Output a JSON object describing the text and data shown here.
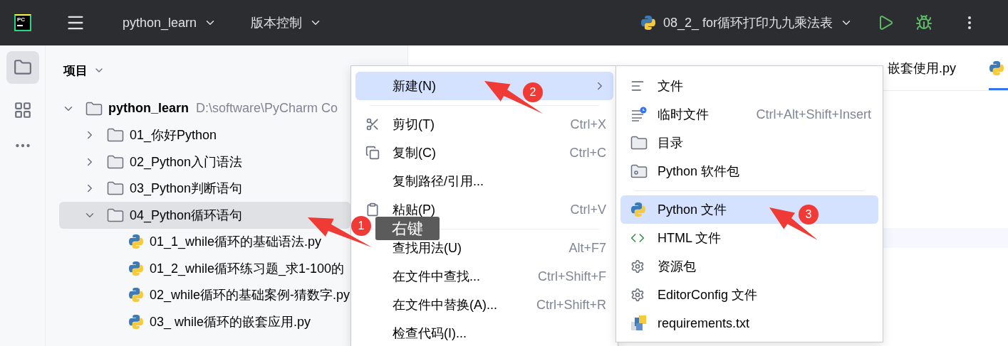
{
  "topbar": {
    "logo_text": "PC",
    "project": "python_learn",
    "vcs": "版本控制",
    "run_config": "08_2_ for循环打印九九乘法表"
  },
  "tool_strip": [
    {
      "selected": true
    },
    {
      "selected": false
    }
  ],
  "project_panel": {
    "title": "项目",
    "tree": [
      {
        "name": "python_learn",
        "path": "D:\\software\\PyCharm Co",
        "kind": "folder",
        "expanded": true,
        "selected": false,
        "children": [
          {
            "name": "01_你好Python",
            "kind": "folder",
            "expanded": false,
            "selected": false
          },
          {
            "name": "02_Python入门语法",
            "kind": "folder",
            "expanded": false,
            "selected": false
          },
          {
            "name": "03_Python判断语句",
            "kind": "folder",
            "expanded": false,
            "selected": false
          },
          {
            "name": "04_Python循环语句",
            "kind": "folder",
            "expanded": true,
            "selected": true,
            "children": [
              {
                "name": "01_1_while循环的基础语法.py",
                "kind": "file",
                "selected": false
              },
              {
                "name": "01_2_while循环练习题_求1-100的",
                "kind": "file",
                "selected": false
              },
              {
                "name": "02_while循环的基础案例-猜数字.py",
                "kind": "file",
                "selected": false
              },
              {
                "name": "03_ while循环的嵌套应用.py",
                "kind": "file",
                "selected": false
              }
            ]
          }
        ]
      }
    ]
  },
  "editor": {
    "tabs": [
      {
        "label": "嵌套使用.py",
        "selected": false
      },
      {
        "selected": true
      }
    ]
  },
  "context_menu": {
    "items": [
      {
        "kind": "item",
        "label": "新建(N)",
        "submenu": true,
        "selected": true
      },
      {
        "kind": "separator"
      },
      {
        "kind": "item",
        "label": "剪切(T)",
        "shortcut": "Ctrl+X",
        "selected": false
      },
      {
        "kind": "item",
        "label": "复制(C)",
        "shortcut": "Ctrl+C",
        "selected": false
      },
      {
        "kind": "item",
        "label": "复制路径/引用...",
        "selected": false
      },
      {
        "kind": "item",
        "label": "粘贴(P)",
        "shortcut": "Ctrl+V",
        "selected": false
      },
      {
        "kind": "separator"
      },
      {
        "kind": "item",
        "label": "查找用法(U)",
        "shortcut": "Alt+F7",
        "selected": false
      },
      {
        "kind": "item",
        "label": "在文件中查找...",
        "shortcut": "Ctrl+Shift+F",
        "selected": false
      },
      {
        "kind": "item",
        "label": "在文件中替换(A)...",
        "shortcut": "Ctrl+Shift+R",
        "selected": false
      },
      {
        "kind": "item",
        "label": "检查代码(I)...",
        "selected": false
      }
    ]
  },
  "submenu": {
    "items": [
      {
        "kind": "item",
        "label": "文件",
        "selected": false
      },
      {
        "kind": "item",
        "label": "临时文件",
        "shortcut": "Ctrl+Alt+Shift+Insert",
        "selected": false
      },
      {
        "kind": "item",
        "label": "目录",
        "selected": false
      },
      {
        "kind": "item",
        "label": "Python 软件包",
        "selected": false
      },
      {
        "kind": "separator"
      },
      {
        "kind": "item",
        "label": "Python 文件",
        "selected": true
      },
      {
        "kind": "item",
        "label": "HTML 文件",
        "selected": false
      },
      {
        "kind": "item",
        "label": "资源包",
        "selected": false
      },
      {
        "kind": "item",
        "label": "EditorConfig 文件",
        "selected": false
      },
      {
        "kind": "item",
        "label": "requirements.txt",
        "selected": false
      }
    ]
  },
  "annotations": {
    "badges": [
      "1",
      "2",
      "3"
    ],
    "tooltip": "右键"
  }
}
